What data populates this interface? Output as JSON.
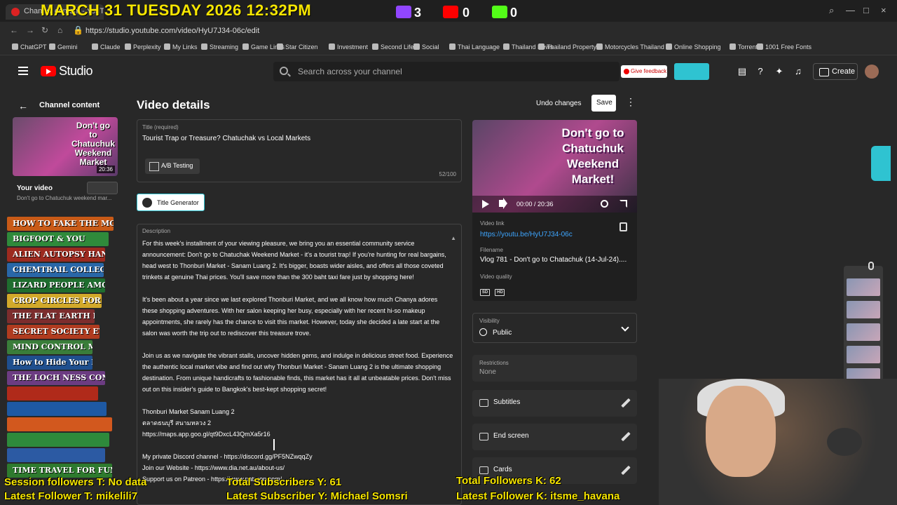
{
  "browser": {
    "tab_title": "Channel content - YouTube Studio",
    "url": "https://studio.youtube.com/video/HyU7J34-06c/edit",
    "window_controls": [
      "—",
      "□",
      "×"
    ]
  },
  "overlay": {
    "date_time": "MARCH 31 TUESDAY 2026 12:32PM",
    "twitch_count": "3",
    "youtube_count": "0",
    "kick_count": "0",
    "session_followers": "Session followers T: No data",
    "total_subscribers": "Total Subscribers Y: 61",
    "total_followers": "Total Followers K: 62",
    "latest_follower_t": "Latest Follower T: mikelili7",
    "latest_subscriber_y": "Latest Subscriber Y: Michael Somsri",
    "latest_follower_k": "Latest Follower K: itsme_havana"
  },
  "bookmarks": [
    "ChatGPT",
    "Gemini",
    "Claude",
    "Perplexity",
    "My Links",
    "Streaming",
    "Game Links",
    "Star Citizen",
    "Investment",
    "Second Life",
    "Social",
    "Thai Language",
    "Thailand News",
    "Thailand Property",
    "Motorcycles Thailand",
    "Online Shopping",
    "Torrents",
    "1001 Free Fonts"
  ],
  "header": {
    "app_name": "Studio",
    "search_placeholder": "Search across your channel",
    "feedback_label": "Give feedback",
    "create_label": "Create"
  },
  "sidebar": {
    "back_label": "Channel content",
    "thumb_text": "Don't go to Chatuchuk Weekend Market",
    "thumb_duration": "20:36",
    "your_video_label": "Your video",
    "your_video_sub": "Don't go to Chatuchuk weekend mar..."
  },
  "books": [
    {
      "label": "HOW TO FAKE THE MOON LANDING",
      "color": "#c85a17"
    },
    {
      "label": "BIGFOOT & YOU",
      "color": "#2f8a3b"
    },
    {
      "label": "ALIEN AUTOPSY HANDBOOK",
      "color": "#9c2a1f"
    },
    {
      "label": "CHEMTRAIL COLLECTION GUIDE",
      "color": "#2967a8"
    },
    {
      "label": "LIZARD PEOPLE AMONG US",
      "color": "#1f6d2f"
    },
    {
      "label": "CROP CIRCLES FOR DUMMIES",
      "color": "#d2a92a"
    },
    {
      "label": "THE FLAT EARTH PRIMER",
      "color": "#7c2d2d"
    },
    {
      "label": "SECRET SOCIETY ETIQUETTE",
      "color": "#b03b1f"
    },
    {
      "label": "MIND CONTROL MADE EASY",
      "color": "#3a7d3a"
    },
    {
      "label": "How to Hide Your Bunker",
      "color": "#1f4f8e"
    },
    {
      "label": "THE LOCH NESS CONSPIRACY",
      "color": "#6c3c82"
    },
    {
      "label": "",
      "color": "#b02a1a"
    },
    {
      "label": "",
      "color": "#1e59a3"
    },
    {
      "label": "",
      "color": "#d2581e"
    },
    {
      "label": "",
      "color": "#2e8a3b"
    },
    {
      "label": "",
      "color": "#2c5aa3"
    },
    {
      "label": "TIME TRAVEL FOR FUN & PROFIT",
      "color": "#2e7a2e"
    }
  ],
  "main": {
    "page_title": "Video details",
    "undo_label": "Undo changes",
    "save_label": "Save",
    "title_label": "Title (required)",
    "title_value": "Tourist Trap or Treasure? Chatuchak vs Local Markets",
    "ab_testing_label": "A/B Testing",
    "title_count": "52/100",
    "title_generator_label": "Title Generator",
    "description_label": "Description",
    "description_paragraphs": [
      "For this week's installment of your viewing pleasure, we bring you an essential community service announcement: Don't go to Chatuchak Weekend Market - it's a tourist trap! If you're hunting for real bargains, head west to Thonburi Market - Sanam Luang 2. It's bigger, boasts wider aisles, and offers all those coveted trinkets at genuine Thai prices. You'll save more than the 300 baht taxi fare just by shopping here!",
      "It's been about a year since we last explored Thonburi Market, and we all know how much Chanya adores these shopping adventures. With her salon keeping her busy, especially with her recent hi-so makeup appointments, she rarely has the chance to visit this market. However, today she decided a late start at the salon was worth the trip out to rediscover this treasure trove.",
      "Join us as we navigate the vibrant stalls, uncover hidden gems, and indulge in delicious street food. Experience the authentic local market vibe and find out why Thonburi Market - Sanam Luang 2 is the ultimate shopping destination. From unique handicrafts to fashionable finds, this market has it all at unbeatable prices. Don't miss out on this insider's guide to Bangkok's best-kept shopping secret!"
    ],
    "desc_line_1": "Thonburi Market Sanam Luang 2",
    "desc_line_2": "ตลาดธนบุรี สนามหลวง 2",
    "desc_line_3": "https://maps.app.goo.gl/qt9DxcL43QmXa5r16",
    "desc_line_4": "My private Discord channel - https://discord.gg/PF5NZwqqZy",
    "desc_line_5": "Join our Website - https://www.dia.net.au/about-us/",
    "desc_line_6": "Support us on Patreon - https://www.patreon.com/..."
  },
  "right_panel": {
    "preview_text": "Don't go to Chatuchuk Weekend Market!",
    "time": "00:00 / 20:36",
    "video_link_label": "Video link",
    "video_link": "https://youtu.be/HyU7J34-06c",
    "filename_label": "Filename",
    "filename": "Vlog 781 - Don't go to Chatachuk (14-Jul-24)....",
    "quality_label": "Video quality",
    "quality_tags": [
      "SD",
      "HD"
    ],
    "visibility_label": "Visibility",
    "visibility_value": "Public",
    "restrictions_label": "Restrictions",
    "restrictions_value": "None",
    "subtitles_label": "Subtitles",
    "end_screen_label": "End screen",
    "cards_label": "Cards"
  }
}
